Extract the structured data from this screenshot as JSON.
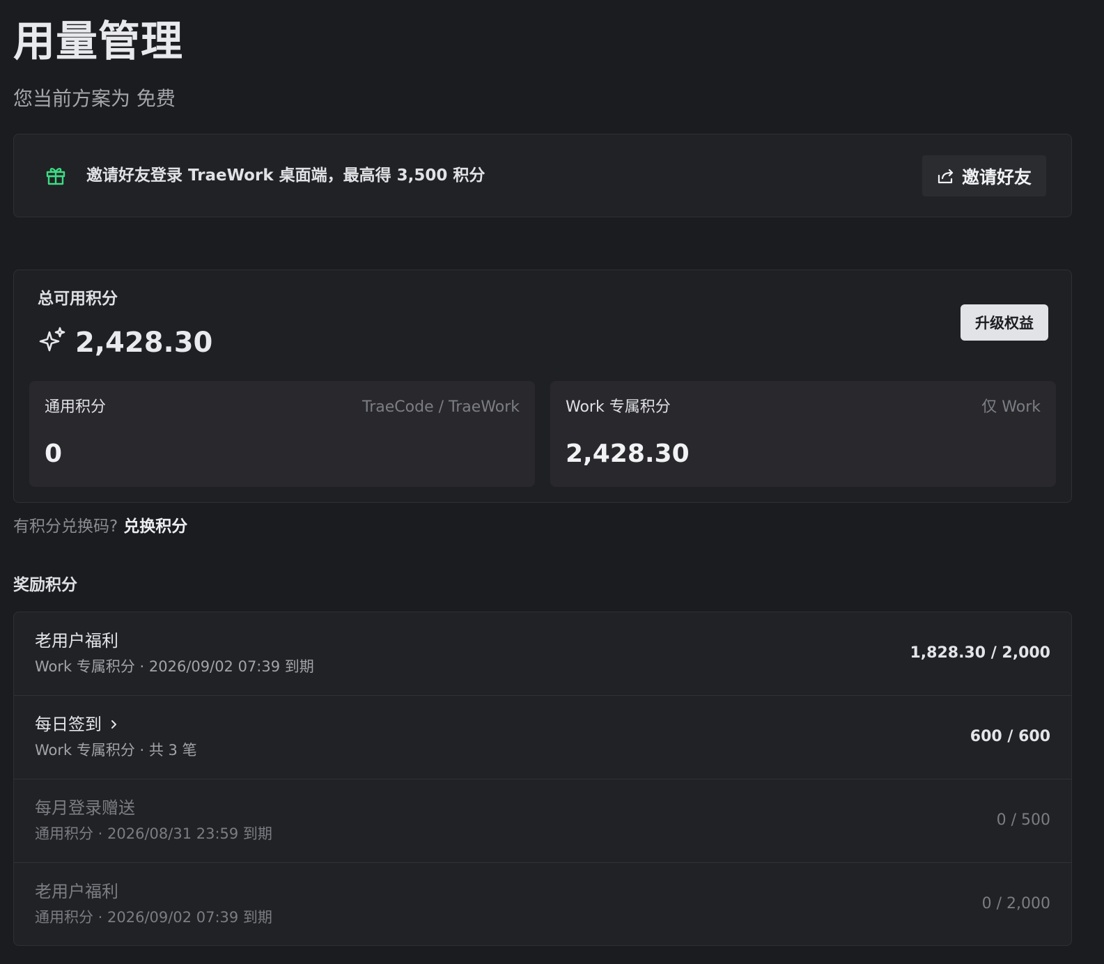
{
  "header": {
    "title": "用量管理",
    "plan_text": "您当前方案为 免费"
  },
  "invite": {
    "icon": "gift-icon",
    "text": "邀请好友登录 TraeWork 桌面端，最高得 3,500 积分",
    "button_label": "邀请好友",
    "button_icon": "share-icon",
    "accent_color": "#3ddc84"
  },
  "credits": {
    "label": "总可用积分",
    "total": "2,428.30",
    "upgrade_label": "升级权益",
    "general": {
      "title": "通用积分",
      "scope": "TraeCode / TraeWork",
      "value": "0"
    },
    "work": {
      "title": "Work 专属积分",
      "scope": "仅 Work",
      "value": "2,428.30"
    }
  },
  "redeem": {
    "hint": "有积分兑换码?",
    "link": "兑换积分"
  },
  "rewards": {
    "title": "奖励积分",
    "items": [
      {
        "name": "老用户福利",
        "meta": "Work 专属积分 · 2026/09/02 07:39 到期",
        "amount": "1,828.30 / 2,000"
      },
      {
        "name": "每日签到",
        "meta": "Work 专属积分 · 共 3 笔",
        "amount": "600 / 600"
      },
      {
        "name": "每月登录赠送",
        "meta": "通用积分 · 2026/08/31 23:59 到期",
        "amount": "0 / 500"
      },
      {
        "name": "老用户福利",
        "meta": "通用积分 · 2026/09/02 07:39 到期",
        "amount": "0 / 2,000"
      }
    ]
  }
}
